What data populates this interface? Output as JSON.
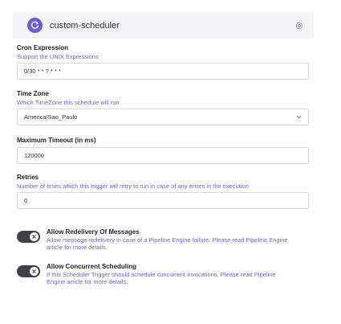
{
  "header": {
    "title": "custom-scheduler",
    "app_icon": "scheduler-app-icon",
    "settings_icon": "gear-icon",
    "accent_color": "#6b5fcf"
  },
  "cron": {
    "label": "Cron Expression",
    "help": "Support the UNIX Expressions",
    "value": "0/30 * * ? * * *"
  },
  "timezone": {
    "label": "Time Zone",
    "help": "Which TimeZone this schedule will run",
    "value": "America/Sao_Paulo"
  },
  "timeout": {
    "label": "Maximum Timeout (in ms)",
    "value": "120000"
  },
  "retries": {
    "label": "Retries",
    "help": "Number of times which this trigger will retry to run in case of any errors in the execution",
    "value": "0"
  },
  "redelivery": {
    "title": "Allow Redelivery Of Messages",
    "description": "Allow message redelivery in case of a Pipeline Engine failure. Please read Pipeline Engine article for more details.",
    "enabled": false
  },
  "concurrent": {
    "title": "Allow Concurrent Scheduling",
    "description": "If this Scheduler Trigger should schedule concurrent invocations. Please read Pipeline Engine article for more details.",
    "enabled": false
  }
}
